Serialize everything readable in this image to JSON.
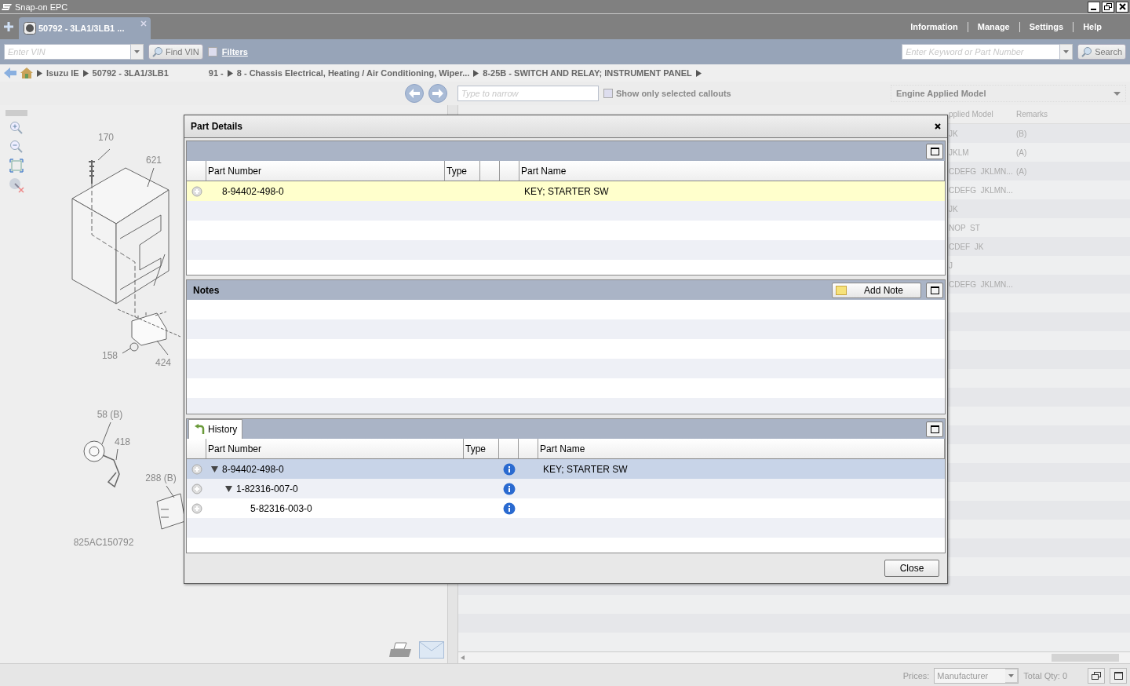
{
  "window": {
    "title": "Snap-on EPC"
  },
  "tabs": [
    {
      "label": "50792 - 3LA1/3LB1 ...",
      "selected": true
    }
  ],
  "nav_links": [
    "Information",
    "Manage",
    "Settings",
    "Help"
  ],
  "vin_field": {
    "placeholder": "Enter VIN"
  },
  "find_vin_button": "Find VIN",
  "filters": {
    "label": "Filters",
    "checked": false
  },
  "keyword_field": {
    "placeholder": "Enter Keyword or Part Number"
  },
  "search_button": "Search",
  "breadcrumb": {
    "items": [
      {
        "label": "Isuzu IE",
        "arrow": true
      },
      {
        "label": "50792 - 3LA1/3LB1",
        "arrow": true
      },
      {
        "label": "91 -",
        "arrow": false
      },
      {
        "label": "8 - Chassis Electrical, Heating / Air Conditioning, Wiper...",
        "arrow": true
      },
      {
        "label": "8-25B - SWITCH AND RELAY; INSTRUMENT PANEL",
        "arrow": true
      }
    ],
    "trailing_arrow": true
  },
  "narrow_field": {
    "placeholder": "Type to narrow"
  },
  "show_selected_callouts": {
    "label": "Show only selected callouts",
    "checked": false
  },
  "model_dropdown": {
    "value": "Engine Applied Model"
  },
  "diagram": {
    "callouts": [
      "170",
      "621",
      "158",
      "424",
      "58 (B)",
      "418",
      "288 (B)"
    ],
    "caption": "825AC150792"
  },
  "parts_table": {
    "headers": {
      "applied_model": "pplied Model",
      "remarks": "Remarks"
    },
    "rows": [
      {
        "applied_model": "JK",
        "remarks": "(B)"
      },
      {
        "applied_model": "JKLM",
        "remarks": "(A)"
      },
      {
        "applied_model": "CDEFG  JKLMN...",
        "remarks": "(A)"
      },
      {
        "applied_model": "CDEFG  JKLMN..."
      },
      {
        "applied_model": "JK"
      },
      {
        "applied_model": "NOP  ST"
      },
      {
        "applied_model": "CDEF  JK"
      },
      {
        "applied_model": "J"
      },
      {
        "applied_model": "CDEFG  JKLMN..."
      }
    ]
  },
  "dialog": {
    "title": "Part Details",
    "part_table": {
      "headers": {
        "part_number": "Part Number",
        "type": "Type",
        "part_name": "Part Name"
      },
      "rows": [
        {
          "part_number": "8-94402-498-0",
          "part_name": "KEY; STARTER SW",
          "selected": true
        }
      ]
    },
    "notes": {
      "title": "Notes",
      "add_button": "Add Note"
    },
    "history": {
      "tab": "History",
      "headers": {
        "part_number": "Part Number",
        "type": "Type",
        "part_name": "Part Name"
      },
      "rows": [
        {
          "part_number": "8-94402-498-0",
          "part_name": "KEY; STARTER SW",
          "selected": true,
          "expanded": true,
          "children": [
            {
              "part_number": "1-82316-007-0",
              "selected": false,
              "expanded": true,
              "children": [
                {
                  "part_number": "5-82316-003-0",
                  "selected": false
                }
              ]
            }
          ]
        }
      ]
    },
    "close_button": "Close"
  },
  "status_bar": {
    "prices_label": "Prices:",
    "prices_value": "Manufacturer",
    "total_qty": "Total Qty: 0"
  }
}
